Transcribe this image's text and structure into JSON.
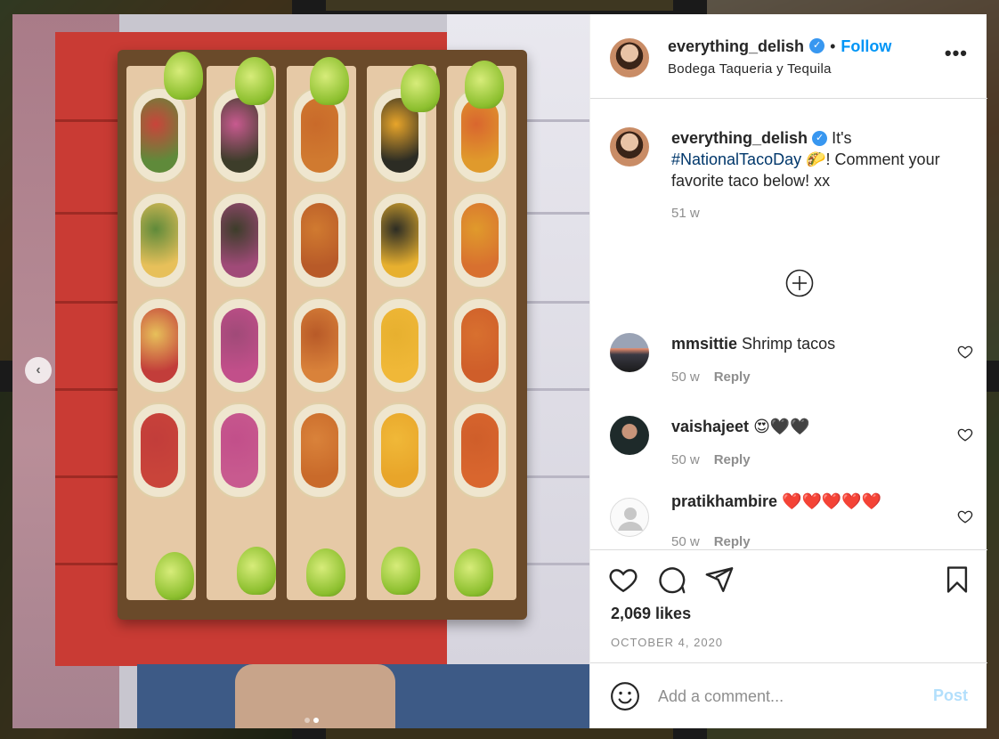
{
  "post": {
    "owner": {
      "username": "everything_delish",
      "verified_mark": "✓",
      "separator": "•",
      "follow_label": "Follow",
      "location": "Bodega Taqueria y Tequila",
      "more_label": "•••"
    },
    "caption": {
      "username": "everything_delish",
      "text_before": " It's ",
      "hashtag": "#NationalTacoDay",
      "emoji": "🌮",
      "text_after": "! Comment your favorite taco below! xx",
      "age": "51 w"
    },
    "comments": [
      {
        "username": "mmsittie",
        "text": "Shrimp tacos",
        "age": "50 w",
        "reply_label": "Reply"
      },
      {
        "username": "vaishajeet",
        "text": "😍🖤🖤",
        "age": "50 w",
        "reply_label": "Reply"
      },
      {
        "username": "pratikhambire",
        "text": "❤️❤️❤️❤️❤️",
        "age": "50 w",
        "reply_label": "Reply"
      }
    ],
    "likes": "2,069 likes",
    "date": "OCTOBER 4, 2020",
    "add_comment": {
      "placeholder": "Add a comment...",
      "post_label": "Post"
    },
    "carousel": {
      "prev_label": "‹",
      "slide_count": 2,
      "active_slide": 2
    }
  },
  "colors": {
    "link_blue": "#0095f6",
    "post_disabled": "#b2dffc",
    "verified_blue": "#3897f0",
    "muted": "#8e8e8e",
    "text": "#262626"
  },
  "icons": {
    "header": "more-options-icon",
    "actions": [
      "heart-icon",
      "comment-icon",
      "share-icon",
      "bookmark-icon"
    ],
    "load_more": "plus-circle-icon",
    "emoji": "emoji-icon"
  }
}
